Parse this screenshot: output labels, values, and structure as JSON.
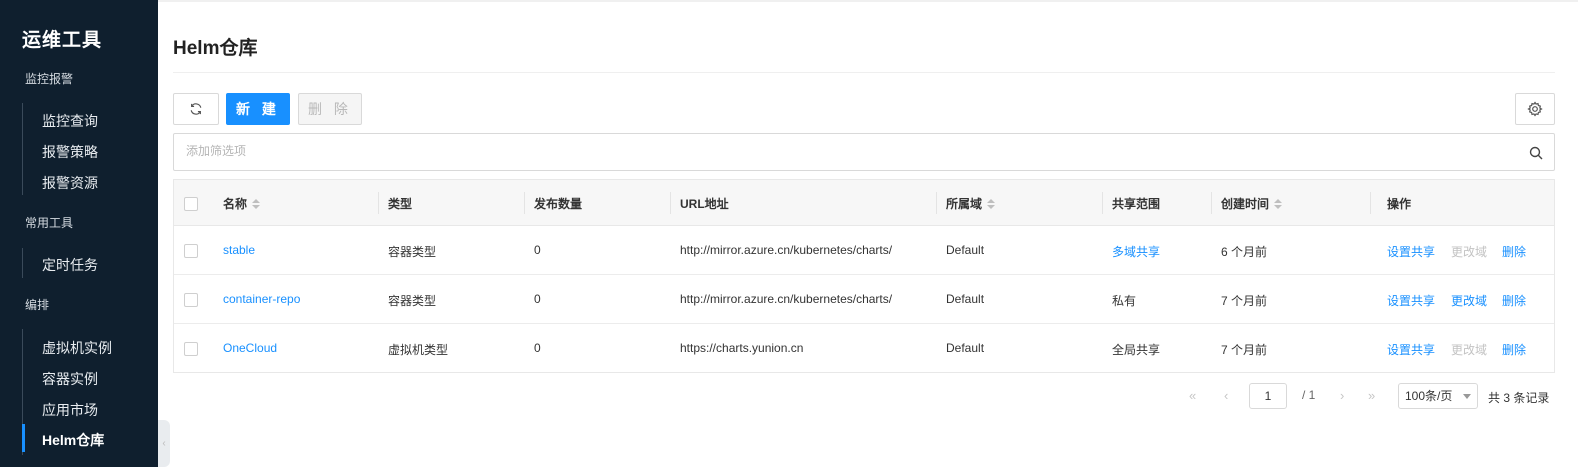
{
  "sidebar": {
    "title": "运维工具",
    "groups": [
      {
        "label": "监控报警",
        "items": [
          "监控查询",
          "报警策略",
          "报警资源"
        ]
      },
      {
        "label": "常用工具",
        "items": [
          "定时任务"
        ]
      },
      {
        "label": "编排",
        "items": [
          "虚拟机实例",
          "容器实例",
          "应用市场",
          "Helm仓库"
        ]
      }
    ],
    "active_item": "Helm仓库"
  },
  "page": {
    "title": "Helm仓库"
  },
  "toolbar": {
    "new_label": "新 建",
    "delete_label": "删 除"
  },
  "filter": {
    "placeholder": "添加筛选项",
    "value": ""
  },
  "table": {
    "columns": [
      "名称",
      "类型",
      "发布数量",
      "URL地址",
      "所属域",
      "共享范围",
      "创建时间",
      "操作"
    ],
    "rows": [
      {
        "name": "stable",
        "type": "容器类型",
        "count": "0",
        "url": "http://mirror.azure.cn/kubernetes/charts/",
        "domain": "Default",
        "scope": "多域共享",
        "created": "6 个月前",
        "actions": [
          "设置共享",
          "更改域",
          "删除"
        ]
      },
      {
        "name": "container-repo",
        "type": "容器类型",
        "count": "0",
        "url": "http://mirror.azure.cn/kubernetes/charts/",
        "domain": "Default",
        "scope": "私有",
        "created": "7 个月前",
        "actions": [
          "设置共享",
          "更改域",
          "删除"
        ]
      },
      {
        "name": "OneCloud",
        "type": "虚拟机类型",
        "count": "0",
        "url": "https://charts.yunion.cn",
        "domain": "Default",
        "scope": "全局共享",
        "created": "7 个月前",
        "actions": [
          "设置共享",
          "更改域",
          "删除"
        ]
      }
    ]
  },
  "pagination": {
    "current": "1",
    "total_pages": "/ 1",
    "page_size": "100条/页",
    "total": "共 3 条记录"
  },
  "colors": {
    "sidebar_bg": "#0f1f2e",
    "primary": "#1890ff",
    "link": "#1890ff",
    "disabled": "#c3c3c3"
  }
}
